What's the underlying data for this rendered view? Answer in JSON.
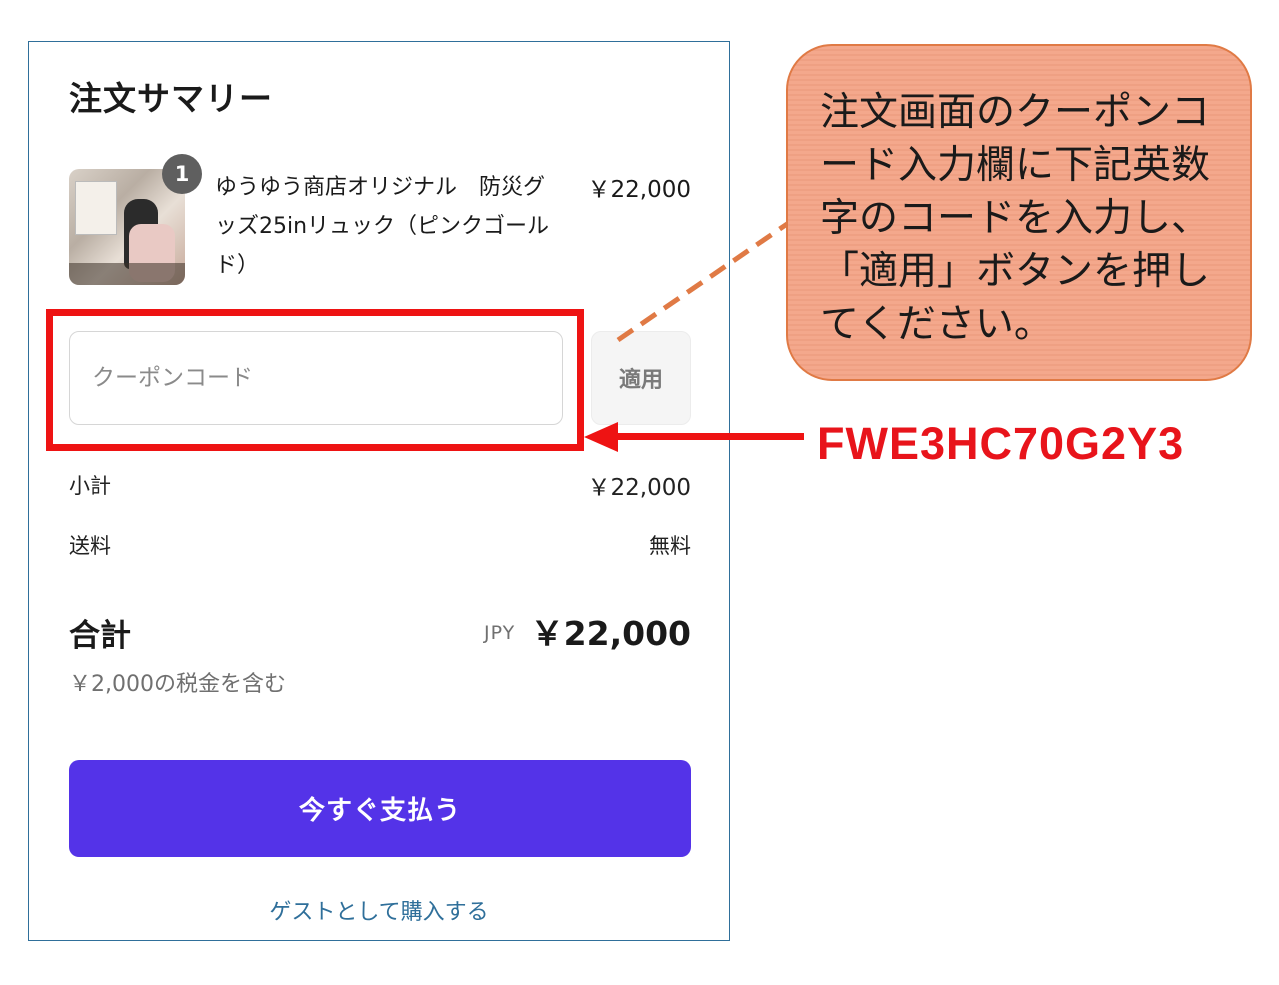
{
  "summary": {
    "title": "注文サマリー",
    "item": {
      "quantity": "1",
      "name": "ゆうゆう商店オリジナル　防災グッズ25inリュック（ピンクゴールド）",
      "price": "￥22,000",
      "image_icon": "product-photo"
    },
    "coupon": {
      "placeholder": "クーポンコード",
      "value": "",
      "apply_label": "適用"
    },
    "subtotal": {
      "label": "小計",
      "value": "￥22,000"
    },
    "shipping": {
      "label": "送料",
      "value": "無料"
    },
    "total": {
      "label": "合計",
      "currency": "JPY",
      "value": "￥22,000",
      "tax_note": "￥2,000の税金を含む"
    },
    "pay_button": "今すぐ支払う",
    "guest_link": "ゲストとして購入する"
  },
  "annotation": {
    "callout_text": "注文画面のクーポンコード入力欄に下記英数字のコードを入力し、「適用」ボタンを押してください。",
    "coupon_code": "FWE3HC70G2Y3",
    "colors": {
      "highlight": "#ee1313",
      "callout_fill": "#f4a88c",
      "connector": "#e07a45",
      "pay_button": "#5433e8"
    }
  }
}
